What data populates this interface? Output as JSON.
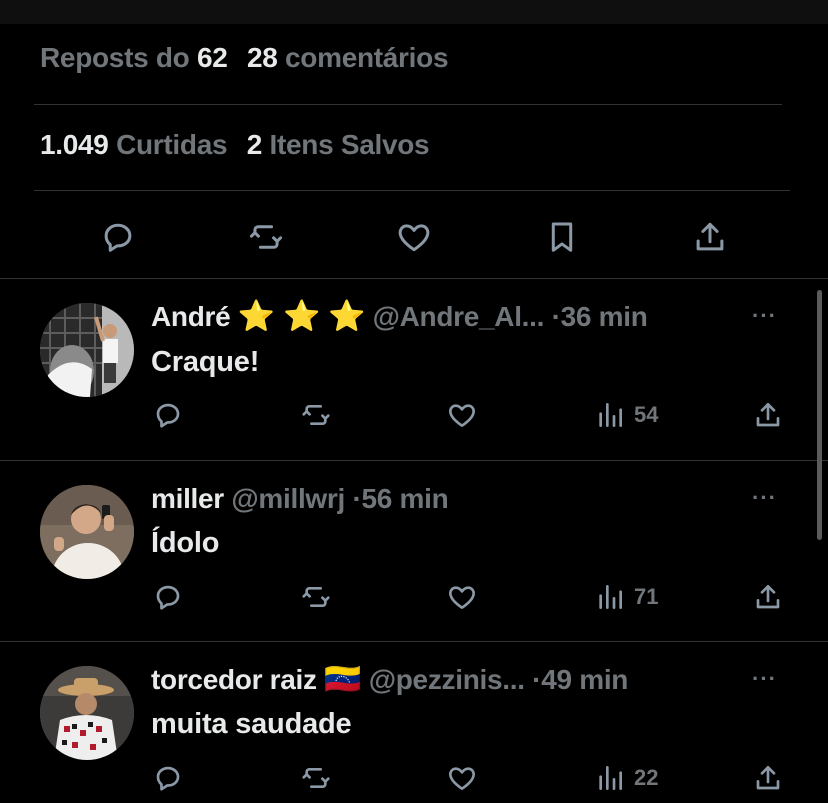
{
  "stats": {
    "reposts_label": "Reposts do",
    "reposts_count": "62",
    "comments_count": "28",
    "comments_label": "comentários",
    "likes_count": "1.049",
    "likes_label": "Curtidas",
    "saves_count": "2",
    "saves_label": "Itens Salvos"
  },
  "action_bar_icons": [
    "reply-icon",
    "repost-icon",
    "like-icon",
    "bookmark-icon",
    "share-icon"
  ],
  "replies": [
    {
      "name": "André",
      "badges": "⭐ ⭐ ⭐",
      "handle": "@Andre_Al...",
      "time": "36 min",
      "text": "Craque!",
      "views": "54"
    },
    {
      "name": "miller",
      "badges": "",
      "handle": "@millwrj",
      "time": "56 min",
      "text": "Ídolo",
      "views": "71"
    },
    {
      "name": "torcedor raiz",
      "badges": "🇻🇪",
      "handle": "@pezzinis...",
      "time": "49 min",
      "text": "muita saudade",
      "views": "22"
    }
  ],
  "dot_sep": "·",
  "more_glyph": "···",
  "colors": {
    "background": "#000000",
    "primary_text": "#e7e9ea",
    "secondary_text": "#71767b",
    "divider": "#2f3336"
  }
}
